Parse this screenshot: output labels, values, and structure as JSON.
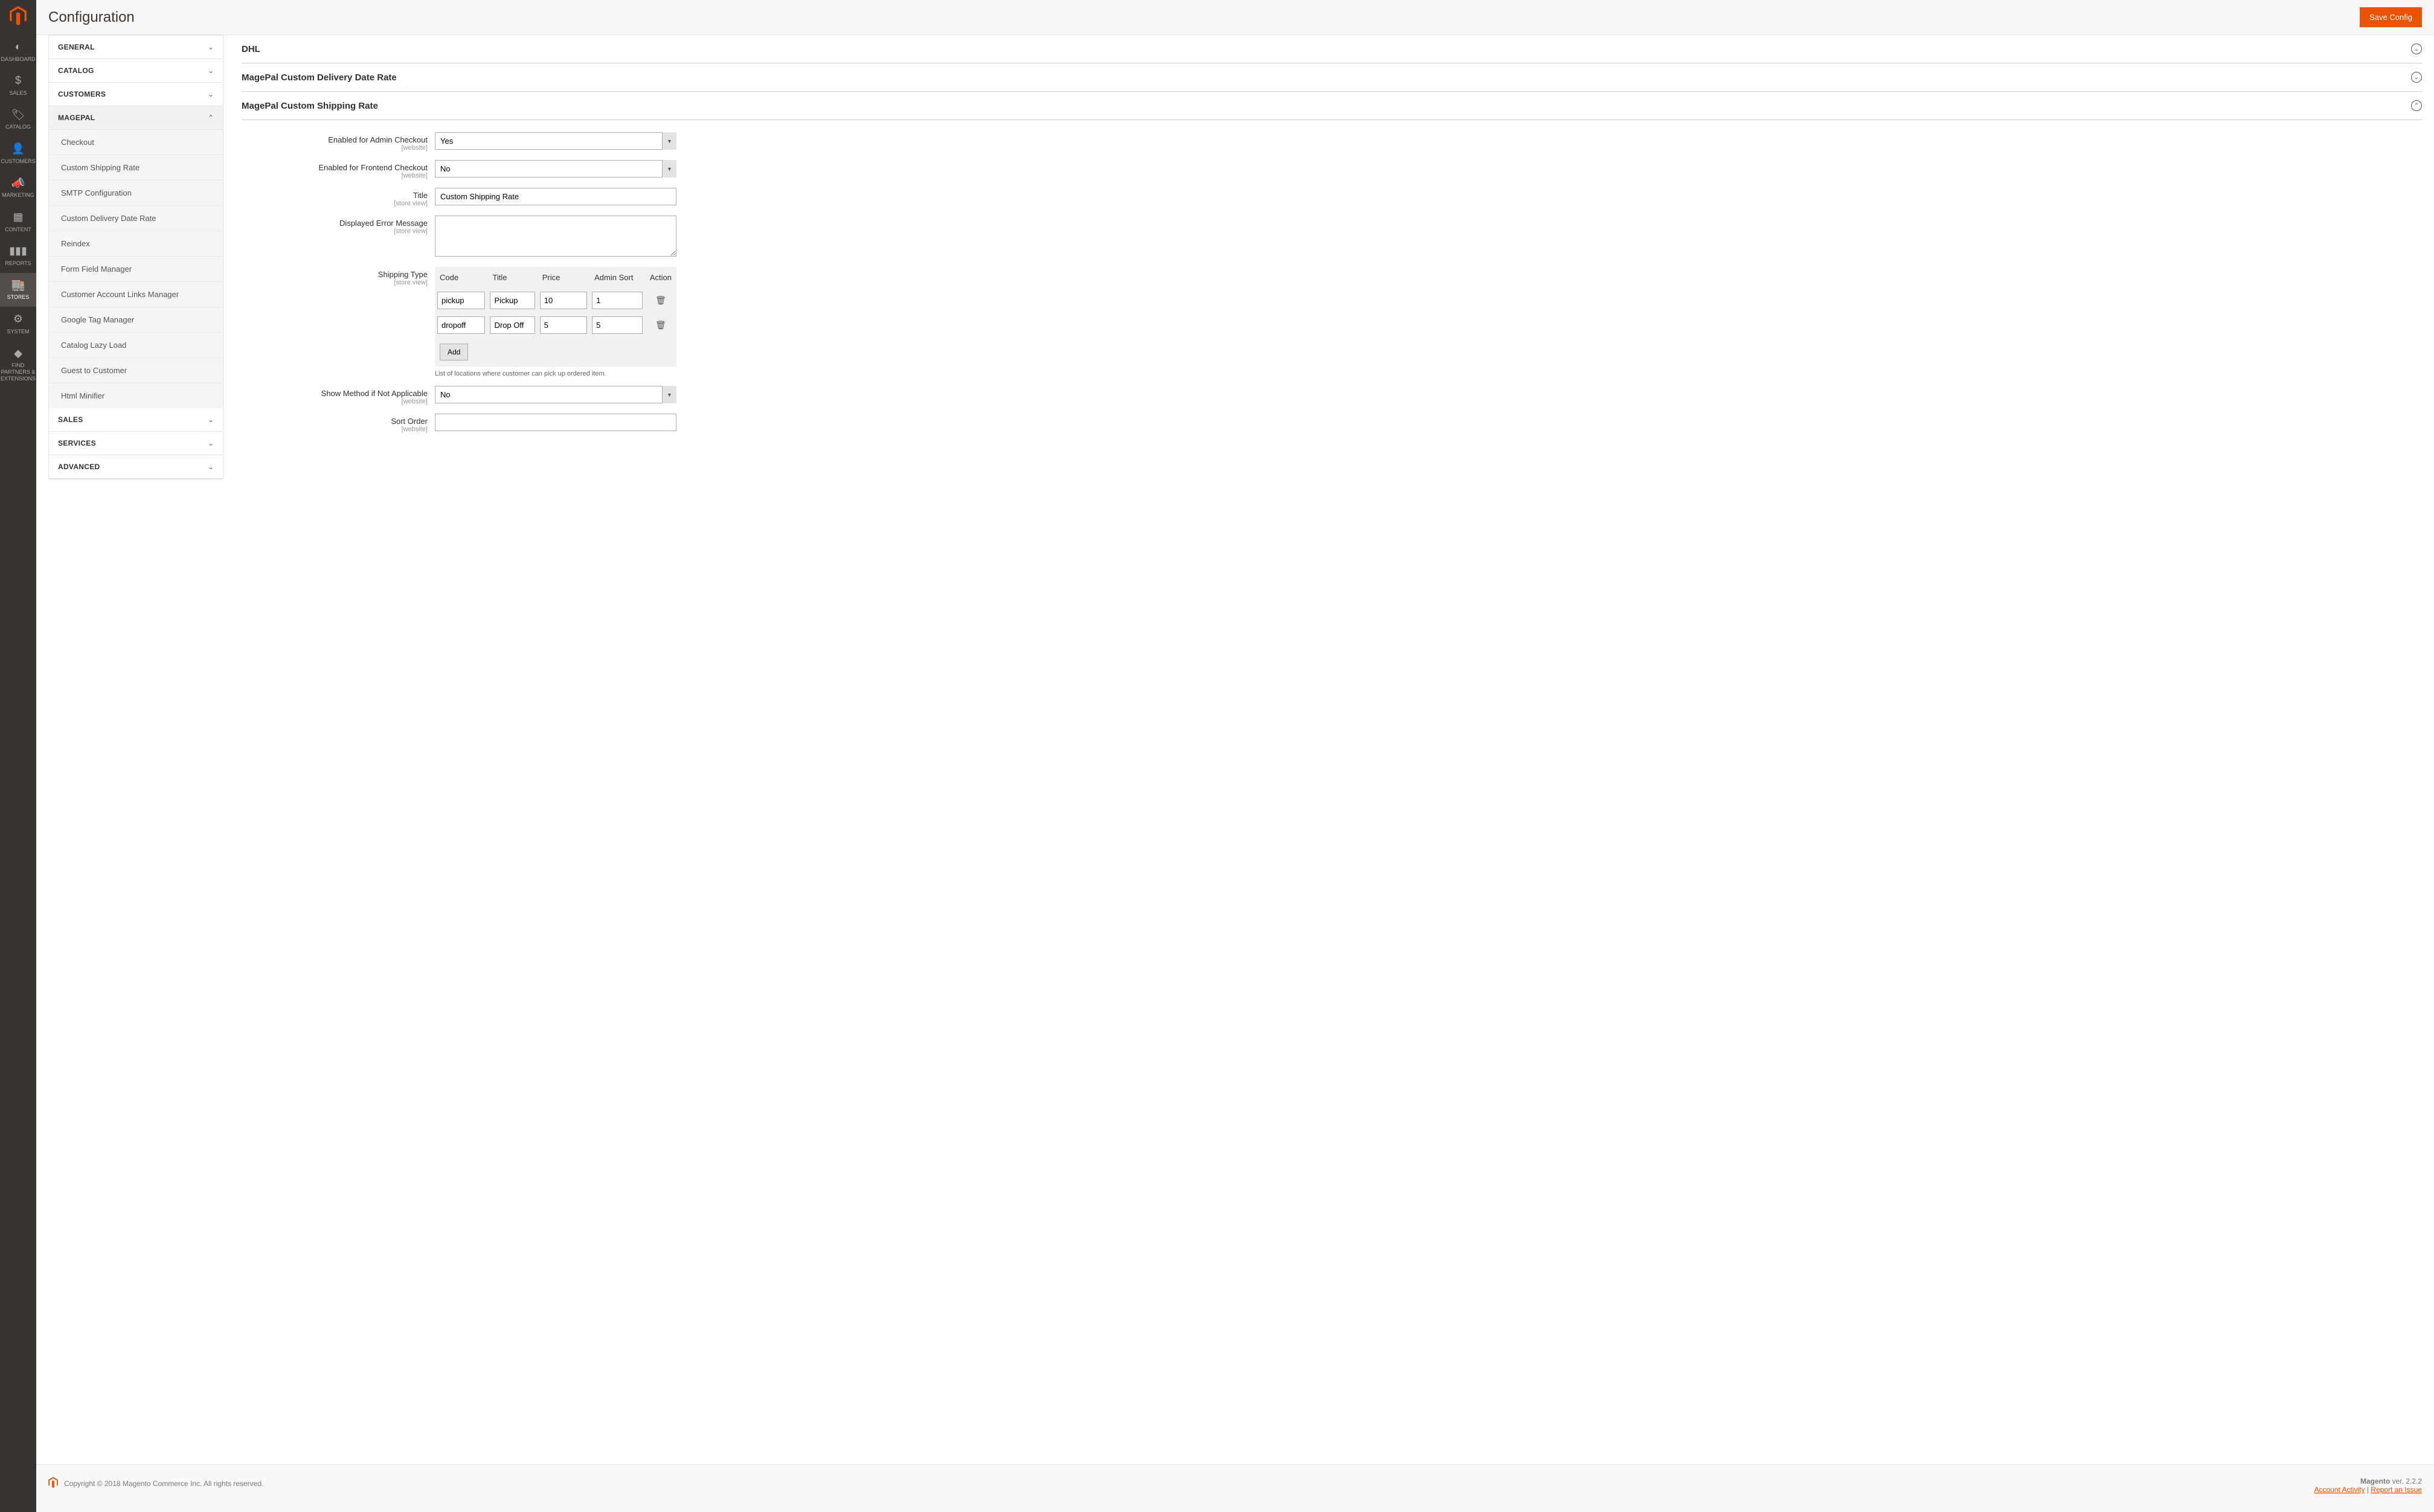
{
  "header": {
    "title": "Configuration",
    "save_btn": "Save Config"
  },
  "leftnav": {
    "items": [
      {
        "label": "DASHBOARD",
        "icon": "dash"
      },
      {
        "label": "SALES",
        "icon": "dollar"
      },
      {
        "label": "CATALOG",
        "icon": "tag"
      },
      {
        "label": "CUSTOMERS",
        "icon": "person"
      },
      {
        "label": "MARKETING",
        "icon": "megaphone"
      },
      {
        "label": "CONTENT",
        "icon": "blocks"
      },
      {
        "label": "REPORTS",
        "icon": "bars"
      },
      {
        "label": "STORES",
        "icon": "store"
      },
      {
        "label": "SYSTEM",
        "icon": "gear"
      },
      {
        "label": "FIND PARTNERS & EXTENSIONS",
        "icon": "cube"
      }
    ]
  },
  "sidebar": {
    "tabs": [
      {
        "label": "GENERAL"
      },
      {
        "label": "CATALOG"
      },
      {
        "label": "CUSTOMERS"
      },
      {
        "label": "MAGEPAL",
        "expanded": true
      },
      {
        "label": "SALES"
      },
      {
        "label": "SERVICES"
      },
      {
        "label": "ADVANCED"
      }
    ],
    "magepal_items": [
      "Checkout",
      "Custom Shipping Rate",
      "SMTP Configuration",
      "Custom Delivery Date Rate",
      "Reindex",
      "Form Field Manager",
      "Customer Account Links Manager",
      "Google Tag Manager",
      "Catalog Lazy Load",
      "Guest to Customer",
      "Html Minifier"
    ]
  },
  "sections": {
    "dhl": "DHL",
    "delivery_date": "MagePal Custom Delivery Date Rate",
    "shipping_rate": "MagePal Custom Shipping Rate"
  },
  "form": {
    "enabled_admin": {
      "label": "Enabled for Admin Checkout",
      "scope": "[website]",
      "value": "Yes"
    },
    "enabled_frontend": {
      "label": "Enabled for Frontend Checkout",
      "scope": "[website]",
      "value": "No"
    },
    "title": {
      "label": "Title",
      "scope": "[store view]",
      "value": "Custom Shipping Rate"
    },
    "error_msg": {
      "label": "Displayed Error Message",
      "scope": "[store view]",
      "value": ""
    },
    "shipping_type": {
      "label": "Shipping Type",
      "scope": "[store view]",
      "headers": {
        "code": "Code",
        "title": "Title",
        "price": "Price",
        "sort": "Admin Sort",
        "action": "Action"
      },
      "rows": [
        {
          "code": "pickup",
          "title": "Pickup",
          "price": "10",
          "sort": "1"
        },
        {
          "code": "dropoff",
          "title": "Drop Off",
          "price": "5",
          "sort": "5"
        }
      ],
      "add_btn": "Add",
      "helper": "List of locations where customer can pick up ordered item."
    },
    "show_method": {
      "label": "Show Method if Not Applicable",
      "scope": "[website]",
      "value": "No"
    },
    "sort_order": {
      "label": "Sort Order",
      "scope": "[website]",
      "value": ""
    }
  },
  "footer": {
    "copyright": "Copyright © 2018 Magento Commerce Inc. All rights reserved.",
    "product": "Magento",
    "version": " ver. 2.2.2",
    "account_activity": "Account Activity",
    "sep": " | ",
    "report_issue": "Report an Issue"
  }
}
